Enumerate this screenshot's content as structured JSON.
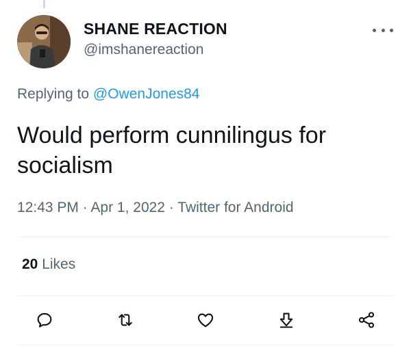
{
  "user": {
    "display_name": "SHANE REACTION",
    "handle": "@imshanereaction"
  },
  "reply": {
    "prefix": "Replying to ",
    "to": "@OwenJones84"
  },
  "tweet": {
    "text": "Would perform cunnilingus for socialism"
  },
  "meta": {
    "time": "12:43 PM",
    "sep1": " · ",
    "date": "Apr 1, 2022",
    "sep2": " · ",
    "source": "Twitter for Android"
  },
  "stats": {
    "likes_count": "20",
    "likes_label": " Likes"
  },
  "actions": [
    {
      "icon": "reply-icon"
    },
    {
      "icon": "retweet-icon"
    },
    {
      "icon": "like-icon"
    },
    {
      "icon": "download-icon"
    },
    {
      "icon": "share-icon"
    }
  ],
  "colors": {
    "text": "#0f1419",
    "secondary": "#536471",
    "accent": "#1d9bf0",
    "divider": "#eff3f4"
  }
}
